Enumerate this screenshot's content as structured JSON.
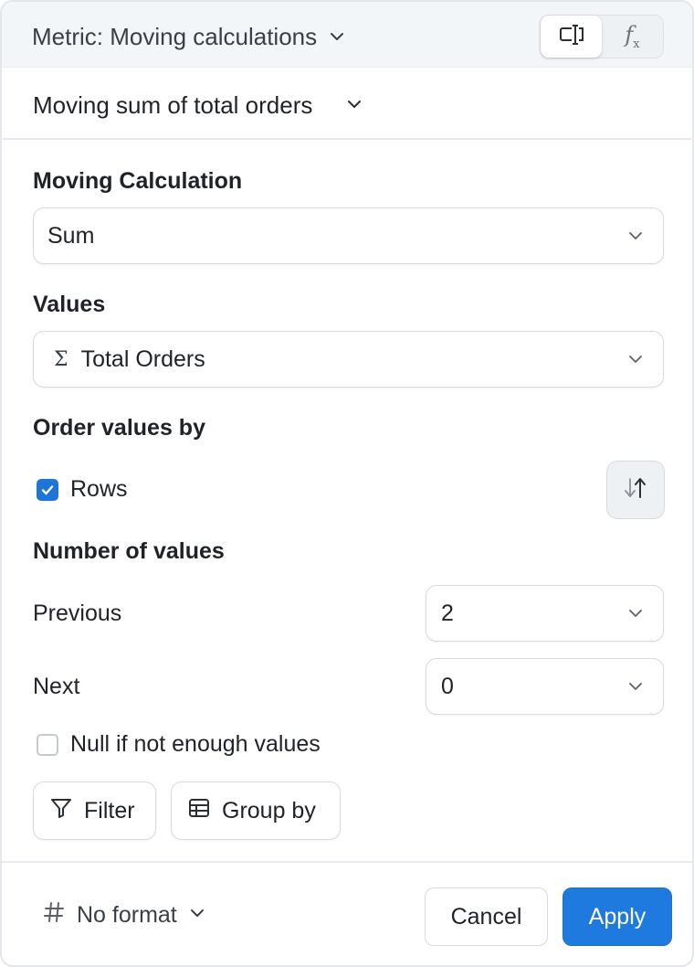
{
  "header": {
    "title": "Metric: Moving calculations",
    "mode_tabs": [
      {
        "icon": "text-cursor-icon",
        "active": true
      },
      {
        "label": "f",
        "sub": "x",
        "icon": "function-icon",
        "active": false
      }
    ]
  },
  "calculation": {
    "name": "Moving sum of total orders"
  },
  "form": {
    "moving_calculation": {
      "label": "Moving Calculation",
      "value": "Sum"
    },
    "values": {
      "label": "Values",
      "value": "Total Orders",
      "icon": "sigma-icon"
    },
    "order_by": {
      "label": "Order values by",
      "option_label": "Rows",
      "checked": true
    },
    "number_of_values": {
      "label": "Number of values",
      "previous": {
        "label": "Previous",
        "value": "2"
      },
      "next": {
        "label": "Next",
        "value": "0"
      }
    },
    "null_option": {
      "label": "Null if not enough values",
      "checked": false
    },
    "actions": {
      "filter": "Filter",
      "group_by": "Group by"
    }
  },
  "footer": {
    "format": "No format",
    "cancel": "Cancel",
    "apply": "Apply"
  },
  "colors": {
    "accent": "#1f7ae0",
    "header_bg": "#f3f6f9",
    "border": "#d6dadf"
  }
}
